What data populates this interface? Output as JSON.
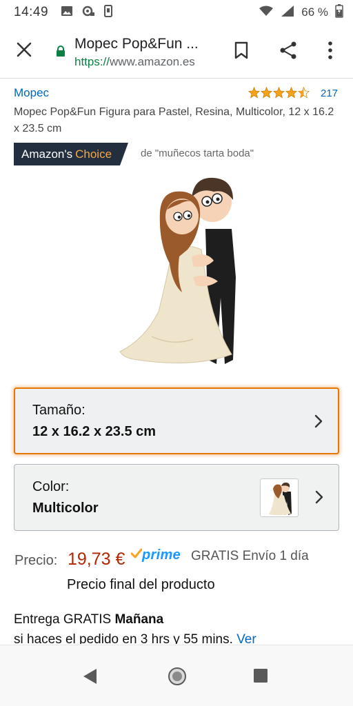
{
  "status": {
    "time": "14:49",
    "battery": "66 %",
    "icons": [
      "image-icon",
      "sync-icon",
      "vibrate-icon",
      "wifi-icon",
      "signal-icon",
      "battery-icon"
    ]
  },
  "browser": {
    "page_title": "Mopec Pop&Fun ...",
    "url_scheme": "https://",
    "url_host": "www.amazon.es",
    "icons": [
      "close-icon",
      "lock-icon",
      "bookmark-icon",
      "share-icon",
      "more-vert-icon"
    ]
  },
  "product": {
    "brand": "Mopec",
    "rating_stars": 4.5,
    "rating_count": "217",
    "title": "Mopec Pop&Fun Figura para Pastel, Resina, Multicolor, 12 x 16.2 x 23.5 cm",
    "badge_main": "Amazon's",
    "badge_accent": "Choice",
    "badge_context": "de \"muñecos tarta boda\""
  },
  "selectors": {
    "size": {
      "label": "Tamaño:",
      "value": "12 x 16.2 x 23.5 cm"
    },
    "color": {
      "label": "Color:",
      "value": "Multicolor"
    }
  },
  "price": {
    "label": "Precio:",
    "value": "19,73 €",
    "prime": "prime",
    "shipping": "GRATIS Envío 1 día",
    "note": "Precio final del producto"
  },
  "delivery": {
    "prefix": "Entrega GRATIS",
    "day": "Mañana",
    "sub": "si haces el pedido en 3 hrs y 55 mins.",
    "link": "Ver"
  },
  "colors": {
    "link": "#0066c0",
    "price": "#b12704",
    "badge_bg": "#232f3e",
    "badge_accent": "#f3a847",
    "prime": "#1a98ff",
    "focus": "#e77600"
  }
}
